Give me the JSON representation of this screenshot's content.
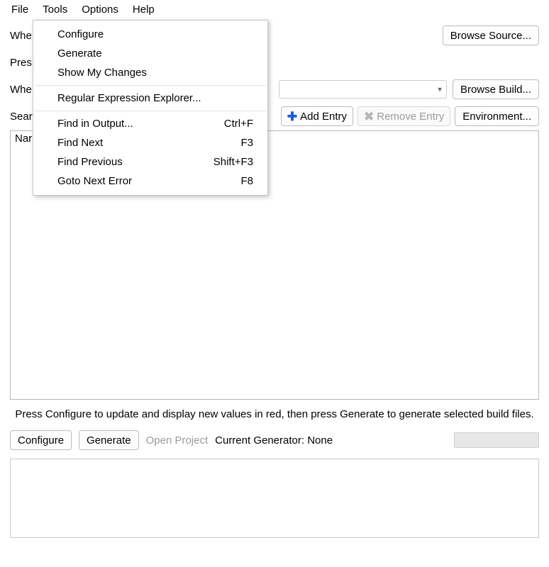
{
  "menubar": {
    "file": "File",
    "tools": "Tools",
    "options": "Options",
    "help": "Help"
  },
  "dropdown": {
    "configure": "Configure",
    "generate": "Generate",
    "show_my_changes": "Show My Changes",
    "regex_explorer": "Regular Expression Explorer...",
    "find_in_output": "Find in Output...",
    "find_in_output_sc": "Ctrl+F",
    "find_next": "Find Next",
    "find_next_sc": "F3",
    "find_previous": "Find Previous",
    "find_previous_sc": "Shift+F3",
    "goto_next_error": "Goto Next Error",
    "goto_next_error_sc": "F8"
  },
  "labels": {
    "where_source": "Whe",
    "preset": "Pres",
    "where_build": "Whe",
    "search": "Sear",
    "name_col": "Nar"
  },
  "buttons": {
    "browse_source": "Browse Source...",
    "browse_build": "Browse Build...",
    "add_entry": "Add Entry",
    "remove_entry": "Remove Entry",
    "environment": "Environment...",
    "configure": "Configure",
    "generate": "Generate",
    "open_project": "Open Project"
  },
  "hint": "Press Configure to update and display new values in red, then press Generate to generate selected build files.",
  "generator_label": "Current Generator: None"
}
